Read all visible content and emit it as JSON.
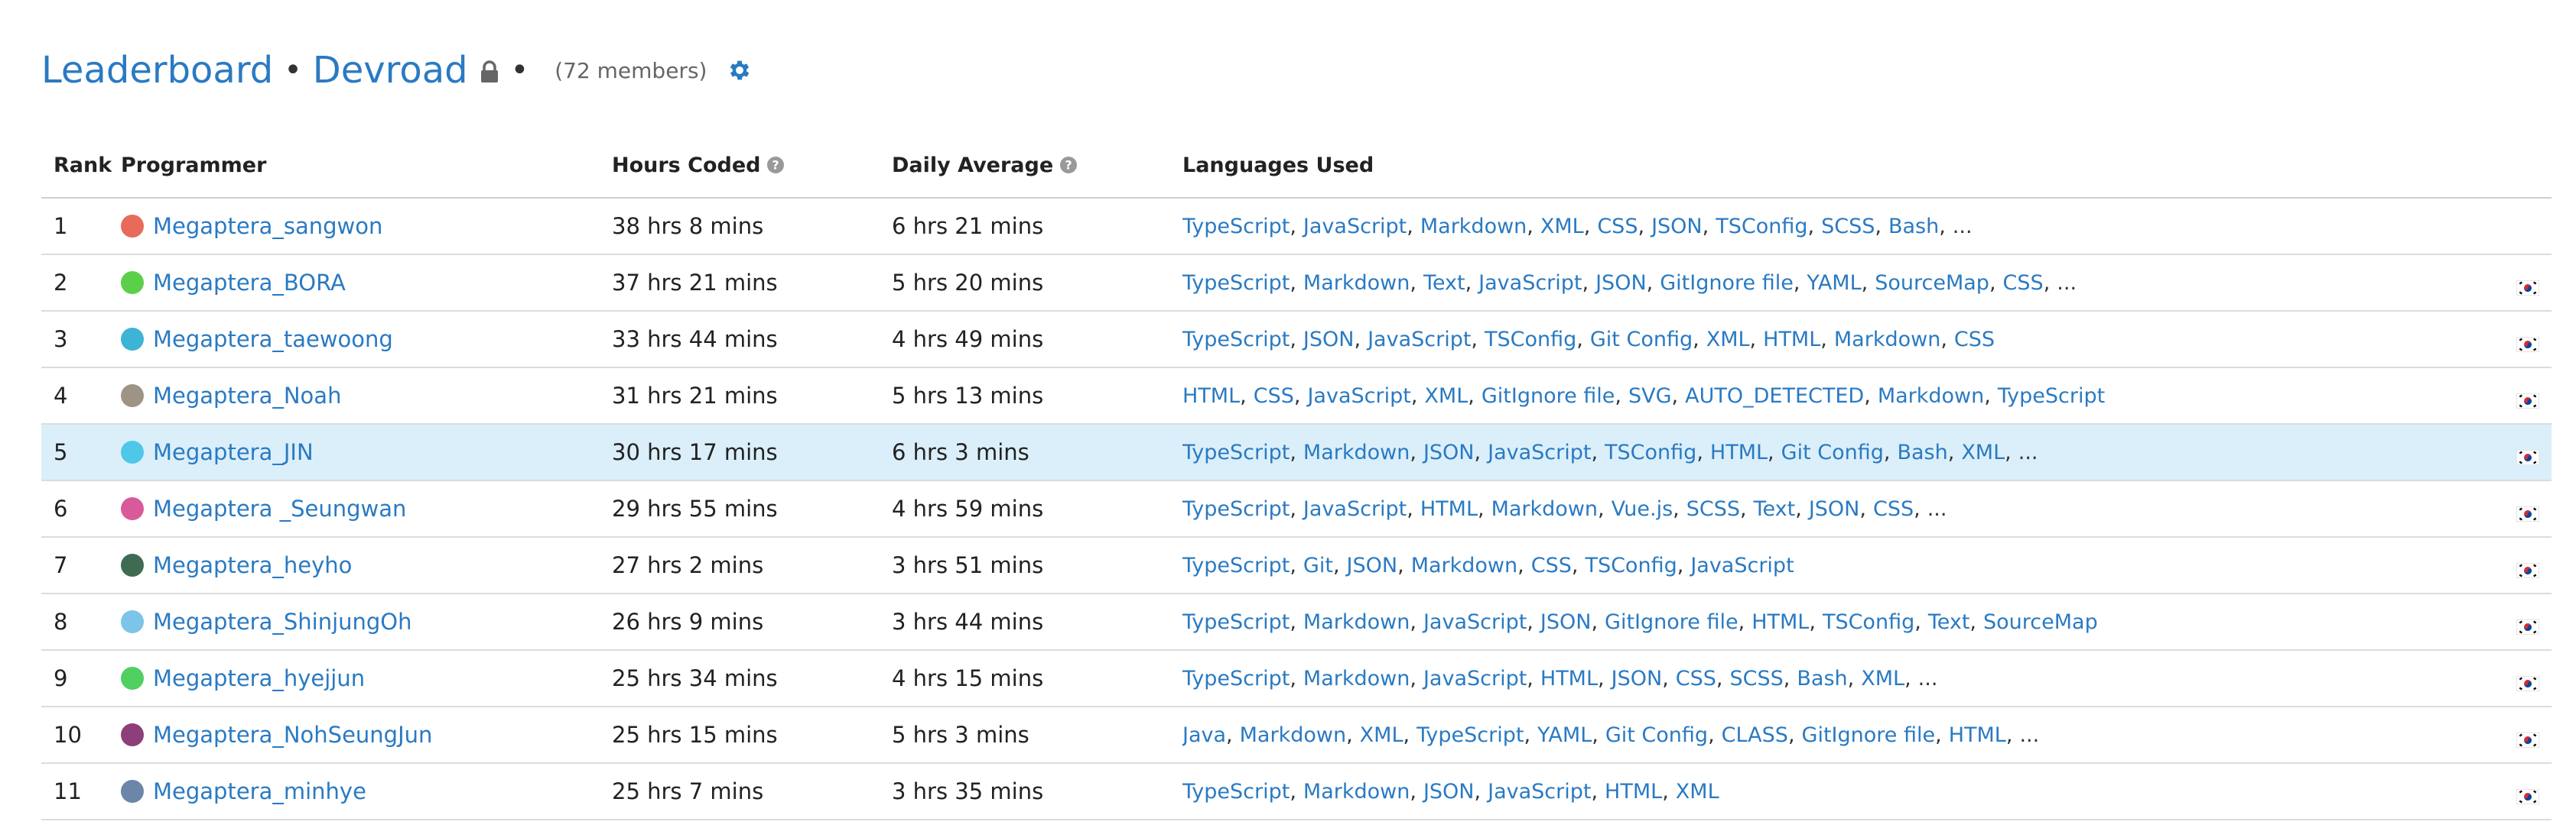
{
  "header": {
    "title": "Leaderboard",
    "separator": "•",
    "team": "Devroad",
    "separator2": "•",
    "members": "(72 members)"
  },
  "table": {
    "columns": {
      "rank": "Rank",
      "programmer": "Programmer",
      "hours": "Hours Coded",
      "daily": "Daily Average",
      "languages": "Languages Used"
    },
    "rows": [
      {
        "rank": "1",
        "name": "Megaptera_sangwon",
        "avatar": "#e86a5a",
        "hours": "38 hrs 8 mins",
        "daily": "6 hrs 21 mins",
        "languages": [
          "TypeScript",
          "JavaScript",
          "Markdown",
          "XML",
          "CSS",
          "JSON",
          "TSConfig",
          "SCSS",
          "Bash"
        ],
        "more": "...",
        "flag": false
      },
      {
        "rank": "2",
        "name": "Megaptera_BORA",
        "avatar": "#5ccf4a",
        "hours": "37 hrs 21 mins",
        "daily": "5 hrs 20 mins",
        "languages": [
          "TypeScript",
          "Markdown",
          "Text",
          "JavaScript",
          "JSON",
          "GitIgnore file",
          "YAML",
          "SourceMap",
          "CSS"
        ],
        "more": "...",
        "flag": true
      },
      {
        "rank": "3",
        "name": "Megaptera_taewoong",
        "avatar": "#3db3d6",
        "hours": "33 hrs 44 mins",
        "daily": "4 hrs 49 mins",
        "languages": [
          "TypeScript",
          "JSON",
          "JavaScript",
          "TSConfig",
          "Git Config",
          "XML",
          "HTML",
          "Markdown",
          "CSS"
        ],
        "more": "",
        "flag": true
      },
      {
        "rank": "4",
        "name": "Megaptera_Noah",
        "avatar": "#9e9486",
        "hours": "31 hrs 21 mins",
        "daily": "5 hrs 13 mins",
        "languages": [
          "HTML",
          "CSS",
          "JavaScript",
          "XML",
          "GitIgnore file",
          "SVG",
          "AUTO_DETECTED",
          "Markdown",
          "TypeScript"
        ],
        "more": "",
        "flag": true
      },
      {
        "rank": "5",
        "name": "Megaptera_JIN",
        "avatar": "#4fc7e8",
        "hours": "30 hrs 17 mins",
        "daily": "6 hrs 3 mins",
        "languages": [
          "TypeScript",
          "Markdown",
          "JSON",
          "JavaScript",
          "TSConfig",
          "HTML",
          "Git Config",
          "Bash",
          "XML"
        ],
        "more": "...",
        "flag": true,
        "highlight": true
      },
      {
        "rank": "6",
        "name": "Megaptera _Seungwan",
        "avatar": "#d95a9a",
        "hours": "29 hrs 55 mins",
        "daily": "4 hrs 59 mins",
        "languages": [
          "TypeScript",
          "JavaScript",
          "HTML",
          "Markdown",
          "Vue.js",
          "SCSS",
          "Text",
          "JSON",
          "CSS"
        ],
        "more": "...",
        "flag": true
      },
      {
        "rank": "7",
        "name": "Megaptera_heyho",
        "avatar": "#3f6b52",
        "hours": "27 hrs 2 mins",
        "daily": "3 hrs 51 mins",
        "languages": [
          "TypeScript",
          "Git",
          "JSON",
          "Markdown",
          "CSS",
          "TSConfig",
          "JavaScript"
        ],
        "more": "",
        "flag": true
      },
      {
        "rank": "8",
        "name": "Megaptera_ShinjungOh",
        "avatar": "#7cc4e8",
        "hours": "26 hrs 9 mins",
        "daily": "3 hrs 44 mins",
        "languages": [
          "TypeScript",
          "Markdown",
          "JavaScript",
          "JSON",
          "GitIgnore file",
          "HTML",
          "TSConfig",
          "Text",
          "SourceMap"
        ],
        "more": "",
        "flag": true
      },
      {
        "rank": "9",
        "name": "Megaptera_hyejjun",
        "avatar": "#4fd061",
        "hours": "25 hrs 34 mins",
        "daily": "4 hrs 15 mins",
        "languages": [
          "TypeScript",
          "Markdown",
          "JavaScript",
          "HTML",
          "JSON",
          "CSS",
          "SCSS",
          "Bash",
          "XML"
        ],
        "more": "...",
        "flag": true
      },
      {
        "rank": "10",
        "name": "Megaptera_NohSeungJun",
        "avatar": "#8c3f78",
        "hours": "25 hrs 15 mins",
        "daily": "5 hrs 3 mins",
        "languages": [
          "Java",
          "Markdown",
          "XML",
          "TypeScript",
          "YAML",
          "Git Config",
          "CLASS",
          "GitIgnore file",
          "HTML"
        ],
        "more": "...",
        "flag": true
      },
      {
        "rank": "11",
        "name": "Megaptera_minhye",
        "avatar": "#6b86a8",
        "hours": "25 hrs 7 mins",
        "daily": "3 hrs 35 mins",
        "languages": [
          "TypeScript",
          "Markdown",
          "JSON",
          "JavaScript",
          "HTML",
          "XML"
        ],
        "more": "",
        "flag": true
      }
    ]
  },
  "icons": {
    "lock": "lock-icon",
    "gear": "gear-icon",
    "help": "question-circle-icon",
    "flag": "south-korea-flag-icon"
  },
  "colors": {
    "link": "#2a7ac2",
    "highlight_row": "#dbeffa",
    "border": "#dcdcdc"
  }
}
